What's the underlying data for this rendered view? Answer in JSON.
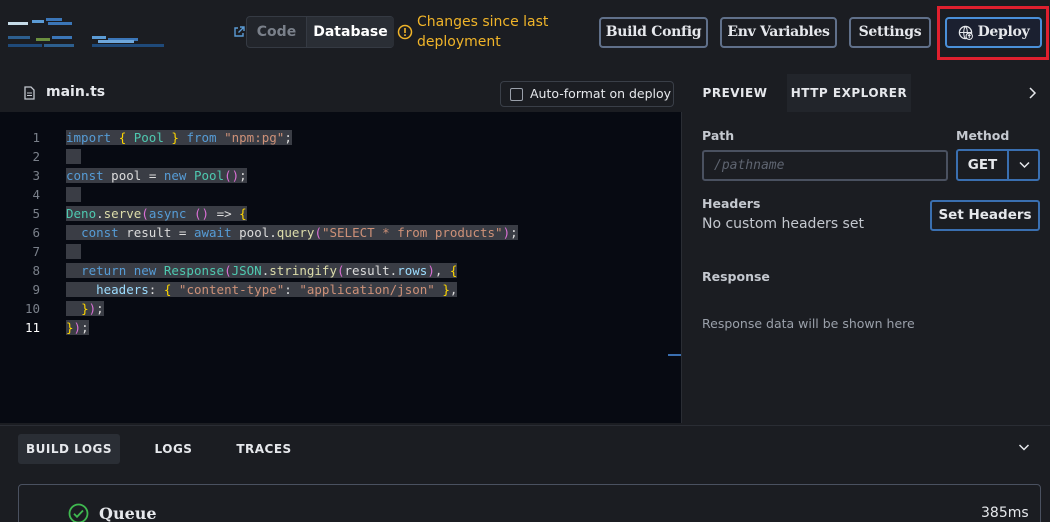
{
  "topbar": {
    "view_toggle": {
      "code_label": "Code",
      "database_label": "Database",
      "selected": "Database"
    },
    "warning_text": "Changes since last deployment",
    "buttons": {
      "build_config": "Build Config",
      "env_variables": "Env Variables",
      "settings": "Settings",
      "deploy": "Deploy"
    },
    "highlight_color": "#e0202e"
  },
  "editor": {
    "file_name": "main.ts",
    "autoformat_label": "Auto-format on deploy",
    "autoformat_checked": false,
    "line_numbers": [
      "1",
      "2",
      "3",
      "4",
      "5",
      "6",
      "7",
      "8",
      "9",
      "10",
      "11"
    ],
    "active_line": "11",
    "code_lines": [
      "import { Pool } from \"npm:pg\";",
      "",
      "const pool = new Pool();",
      "",
      "Deno.serve(async () => {",
      "  const result = await pool.query(\"SELECT * from products\");",
      "",
      "  return new Response(JSON.stringify(result.rows), {",
      "    headers: { \"content-type\": \"application/json\" },",
      "  });",
      "});"
    ]
  },
  "http_explorer": {
    "tabs": [
      "PREVIEW",
      "HTTP EXPLORER"
    ],
    "active_tab": "HTTP EXPLORER",
    "path_label": "Path",
    "path_placeholder": "/pathname",
    "path_value": "",
    "method_label": "Method",
    "method_value": "GET",
    "headers_label": "Headers",
    "headers_empty": "No custom headers set",
    "set_headers_button": "Set Headers",
    "response_label": "Response",
    "response_empty": "Response data will be shown here"
  },
  "bottom": {
    "tabs": [
      "BUILD LOGS",
      "LOGS",
      "TRACES"
    ],
    "active_tab": "BUILD LOGS",
    "queue": {
      "title": "Queue",
      "duration": "385ms",
      "status_color": "#3fb950"
    }
  }
}
